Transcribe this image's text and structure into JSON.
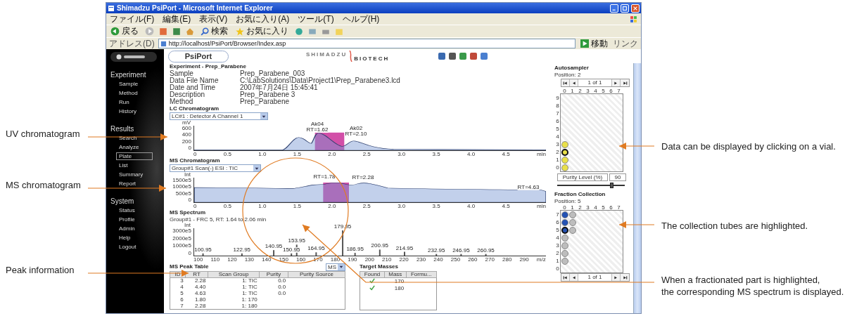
{
  "browser": {
    "title": "Shimadzu PsiPort - Microsoft Internet Explorer",
    "menu": [
      "ファイル(F)",
      "編集(E)",
      "表示(V)",
      "お気に入り(A)",
      "ツール(T)",
      "ヘルプ(H)"
    ],
    "toolbar": {
      "back": "戻る",
      "search": "検索",
      "favorites": "お気に入り"
    },
    "address_label": "アドレス(D)",
    "address": "http://localhost/PsiPort/Browser/Index.asp",
    "go_label": "移動",
    "links_label": "リンク"
  },
  "app": {
    "tab": "PsiPort",
    "logo_top": "SHIMADZU",
    "logo_bottom": "BIOTECH"
  },
  "sidebar": {
    "sections": [
      {
        "title": "Experiment",
        "items": [
          {
            "label": "Sample",
            "selected": false
          },
          {
            "label": "Method",
            "selected": false
          },
          {
            "label": "Run",
            "selected": false
          },
          {
            "label": "History",
            "selected": false
          }
        ]
      },
      {
        "title": "Results",
        "items": [
          {
            "label": "Search",
            "selected": false
          },
          {
            "label": "Analyze",
            "selected": false
          },
          {
            "label": "Plate",
            "selected": true
          },
          {
            "label": "List",
            "selected": false
          },
          {
            "label": "Summary",
            "selected": false
          },
          {
            "label": "Report",
            "selected": false
          }
        ]
      },
      {
        "title": "System",
        "items": [
          {
            "label": "Status",
            "selected": false
          },
          {
            "label": "Profile",
            "selected": false
          },
          {
            "label": "Admin",
            "selected": false
          },
          {
            "label": "Help",
            "selected": false
          },
          {
            "label": "Logout",
            "selected": false
          }
        ]
      }
    ]
  },
  "experiment": {
    "title": "Experiment - Prep_Parabene",
    "fields": [
      {
        "label": "Sample",
        "value": "Prep_Parabene_003"
      },
      {
        "label": "Data File Name",
        "value": "C:\\LabSolutions\\Data\\Project1\\Prep_Parabene3.lcd"
      },
      {
        "label": "Date and Time",
        "value": "2007年7月24日 15:45:41"
      },
      {
        "label": "Description",
        "value": "Prep_Parabene 3"
      },
      {
        "label": "Method",
        "value": "Prep_Parabene"
      }
    ]
  },
  "lc_chromatogram": {
    "title": "LC Chromatogram",
    "select": "LC#1 : Detector A Channel 1",
    "y_unit": "mV",
    "yticks": [
      "600",
      "400",
      "200",
      "0"
    ],
    "xticks": [
      "0",
      "0.5",
      "1.0",
      "1.5",
      "2.0",
      "2.5",
      "3.0",
      "3.5",
      "4.0",
      "4.5"
    ],
    "x_unit": "min",
    "peaks": [
      {
        "name": "Ak04",
        "rt": "RT=1.62"
      },
      {
        "name": "Ak02",
        "rt": "RT=2.10"
      }
    ]
  },
  "ms_chromatogram": {
    "title": "MS Chromatogram",
    "select": "Group#1 Scan(-) ESI : TIC",
    "y_unit": "Int",
    "yticks": [
      "1500e5",
      "1000e5",
      "500e5",
      "0"
    ],
    "xticks": [
      "0",
      "0.5",
      "1.0",
      "1.5",
      "2.0",
      "2.5",
      "3.0",
      "3.5",
      "4.0",
      "4.5"
    ],
    "x_unit": "min",
    "peaks": [
      {
        "rt": "RT=1.78"
      },
      {
        "rt": "RT=2.28"
      },
      {
        "rt": "RT=4.63"
      }
    ]
  },
  "ms_spectrum": {
    "title": "MS Spectrum",
    "subtitle": "Group#1 - FRC 5, RT: 1.64 to 2.06 min",
    "y_unit": "Int",
    "yticks": [
      "3000e5",
      "2000e5",
      "1000e5",
      "0"
    ],
    "xticks": [
      "100",
      "110",
      "120",
      "130",
      "140",
      "150",
      "160",
      "170",
      "180",
      "190",
      "200",
      "210",
      "220",
      "230",
      "240",
      "250",
      "260",
      "270",
      "280",
      "290"
    ],
    "x_unit": "m/z",
    "peaks": [
      "100.95",
      "122.95",
      "140.95",
      "150.95",
      "153.95",
      "164.95",
      "179.95",
      "186.95",
      "200.95",
      "214.95",
      "232.95",
      "246.95",
      "260.95"
    ]
  },
  "peak_table": {
    "title": "MS Peak Table",
    "select": "MS",
    "columns": [
      "ID",
      "RT",
      "Scan Group",
      "Purity",
      "Purity Source"
    ],
    "rows": [
      [
        "3",
        "2.28",
        "1: TIC",
        "0.0",
        ""
      ],
      [
        "4",
        "4.40",
        "1: TIC",
        "0.0",
        ""
      ],
      [
        "5",
        "4.63",
        "1: TIC",
        "0.0",
        ""
      ],
      [
        "6",
        "1.80",
        "1: 170",
        "",
        ""
      ],
      [
        "7",
        "2.28",
        "1: 180",
        "",
        ""
      ]
    ]
  },
  "target_masses": {
    "title": "Target Masses",
    "columns": [
      "Found",
      "Mass",
      "Formu..."
    ],
    "rows": [
      {
        "found": true,
        "mass": "170"
      },
      {
        "found": true,
        "mass": "180"
      }
    ]
  },
  "autosampler": {
    "title": "Autosampler",
    "position": "Position: 2",
    "page": "1 of 1",
    "columns": [
      "0",
      "1",
      "2",
      "3",
      "4",
      "5",
      "6",
      "7"
    ],
    "rows": [
      {
        "label": "9"
      },
      {
        "label": "8"
      },
      {
        "label": "7"
      },
      {
        "label": "6"
      },
      {
        "label": "5"
      },
      {
        "label": "4"
      },
      {
        "label": "3",
        "vials": [
          {
            "kind": "sample",
            "selected": false
          }
        ]
      },
      {
        "label": "2",
        "vials": [
          {
            "kind": "sample",
            "selected": true
          }
        ]
      },
      {
        "label": "1",
        "vials": [
          {
            "kind": "sample",
            "selected": false
          }
        ]
      },
      {
        "label": "0",
        "vials": [
          {
            "kind": "sample",
            "selected": false
          }
        ]
      }
    ],
    "purity": {
      "label": "Purity Level (%)",
      "value": "90",
      "level": 0.8
    }
  },
  "fraction_collection": {
    "title": "Fraction Collection",
    "position": "Position: 5",
    "page": "1 of 1",
    "columns": [
      "0",
      "1",
      "2",
      "3",
      "4",
      "5",
      "6",
      "7"
    ],
    "rows": [
      {
        "label": "7",
        "vials": [
          {
            "kind": "collected",
            "selected": false
          },
          {
            "kind": "tube",
            "selected": false
          }
        ]
      },
      {
        "label": "6",
        "vials": [
          {
            "kind": "collected",
            "selected": false
          },
          {
            "kind": "tube",
            "selected": false
          }
        ]
      },
      {
        "label": "5",
        "vials": [
          {
            "kind": "collected",
            "selected": true
          },
          {
            "kind": "tube",
            "selected": false
          }
        ]
      },
      {
        "label": "4",
        "vials": [
          {
            "kind": "tube",
            "selected": false
          }
        ]
      },
      {
        "label": "3",
        "vials": [
          {
            "kind": "tube",
            "selected": false
          }
        ]
      },
      {
        "label": "2",
        "vials": [
          {
            "kind": "tube",
            "selected": false
          }
        ]
      },
      {
        "label": "1",
        "vials": [
          {
            "kind": "tube",
            "selected": false
          }
        ]
      },
      {
        "label": "0"
      }
    ]
  },
  "callouts_left": [
    {
      "lines": [
        "UV chromatogram"
      ]
    },
    {
      "lines": [
        "MS chromatogram"
      ]
    },
    {
      "lines": [
        "Peak information"
      ]
    }
  ],
  "callouts_right": [
    {
      "lines": [
        "Data can be displayed by clicking on a vial."
      ]
    },
    {
      "lines": [
        "The collection tubes are highlighted."
      ]
    },
    {
      "lines": [
        "When a fractionated part is highlighted,",
        "the corresponding MS spectrum is displayed."
      ]
    }
  ]
}
